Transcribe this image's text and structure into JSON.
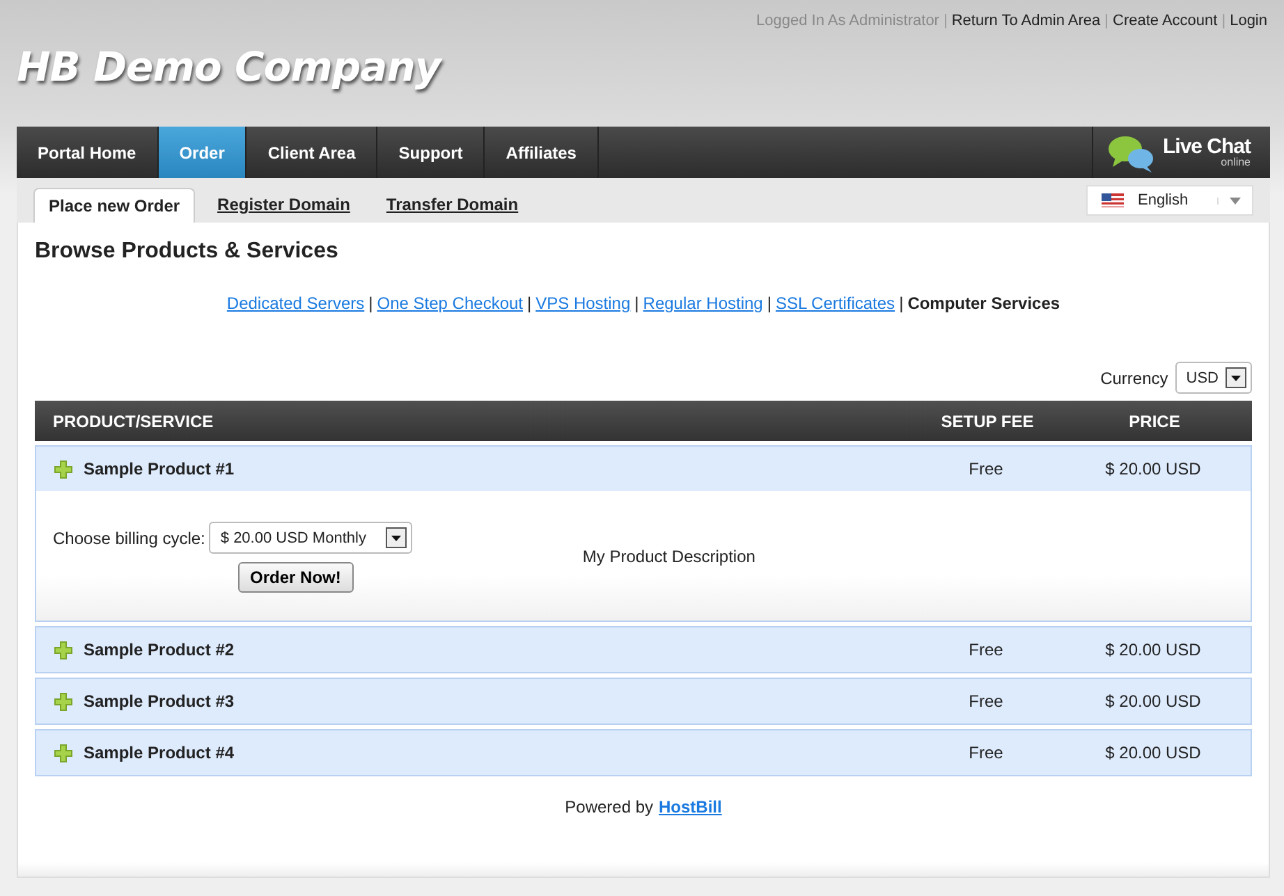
{
  "top_links": {
    "status": "Logged In As Administrator",
    "separator": "|",
    "links": [
      "Return To Admin Area",
      "Create Account",
      "Login"
    ]
  },
  "company": "HB Demo Company",
  "nav": [
    {
      "label": "Portal Home",
      "selected": false
    },
    {
      "label": "Order",
      "selected": true
    },
    {
      "label": "Client Area",
      "selected": false
    },
    {
      "label": "Support",
      "selected": false
    },
    {
      "label": "Affiliates",
      "selected": false
    }
  ],
  "live_chat": {
    "title": "Live Chat",
    "status": "online"
  },
  "subtabs": [
    {
      "label": "Place new Order",
      "selected": true
    },
    {
      "label": "Register Domain",
      "selected": false
    },
    {
      "label": "Transfer Domain",
      "selected": false
    }
  ],
  "language": "English",
  "heading": "Browse Products & Services",
  "categories": [
    {
      "label": "Dedicated Servers",
      "selected": false
    },
    {
      "label": "One Step Checkout",
      "selected": false
    },
    {
      "label": "VPS Hosting",
      "selected": false
    },
    {
      "label": "Regular Hosting",
      "selected": false
    },
    {
      "label": "SSL Certificates",
      "selected": false
    },
    {
      "label": "Computer Services",
      "selected": true
    }
  ],
  "category_separator": "|",
  "currency": {
    "label": "Currency",
    "value": "USD"
  },
  "table": {
    "columns": [
      "PRODUCT/SERVICE",
      "SETUP FEE",
      "PRICE"
    ],
    "rows": [
      {
        "name": "Sample Product #1",
        "setup_fee": "Free",
        "price": "$ 20.00 USD",
        "expanded": true,
        "billing_label": "Choose billing cycle:",
        "billing_value": "$ 20.00 USD Monthly",
        "order_button": "Order Now!",
        "description": "My Product Description"
      },
      {
        "name": "Sample Product #2",
        "setup_fee": "Free",
        "price": "$ 20.00 USD",
        "expanded": false
      },
      {
        "name": "Sample Product #3",
        "setup_fee": "Free",
        "price": "$ 20.00 USD",
        "expanded": false
      },
      {
        "name": "Sample Product #4",
        "setup_fee": "Free",
        "price": "$ 20.00 USD",
        "expanded": false
      }
    ]
  },
  "footer": {
    "text": "Powered by",
    "link": "HostBill"
  }
}
